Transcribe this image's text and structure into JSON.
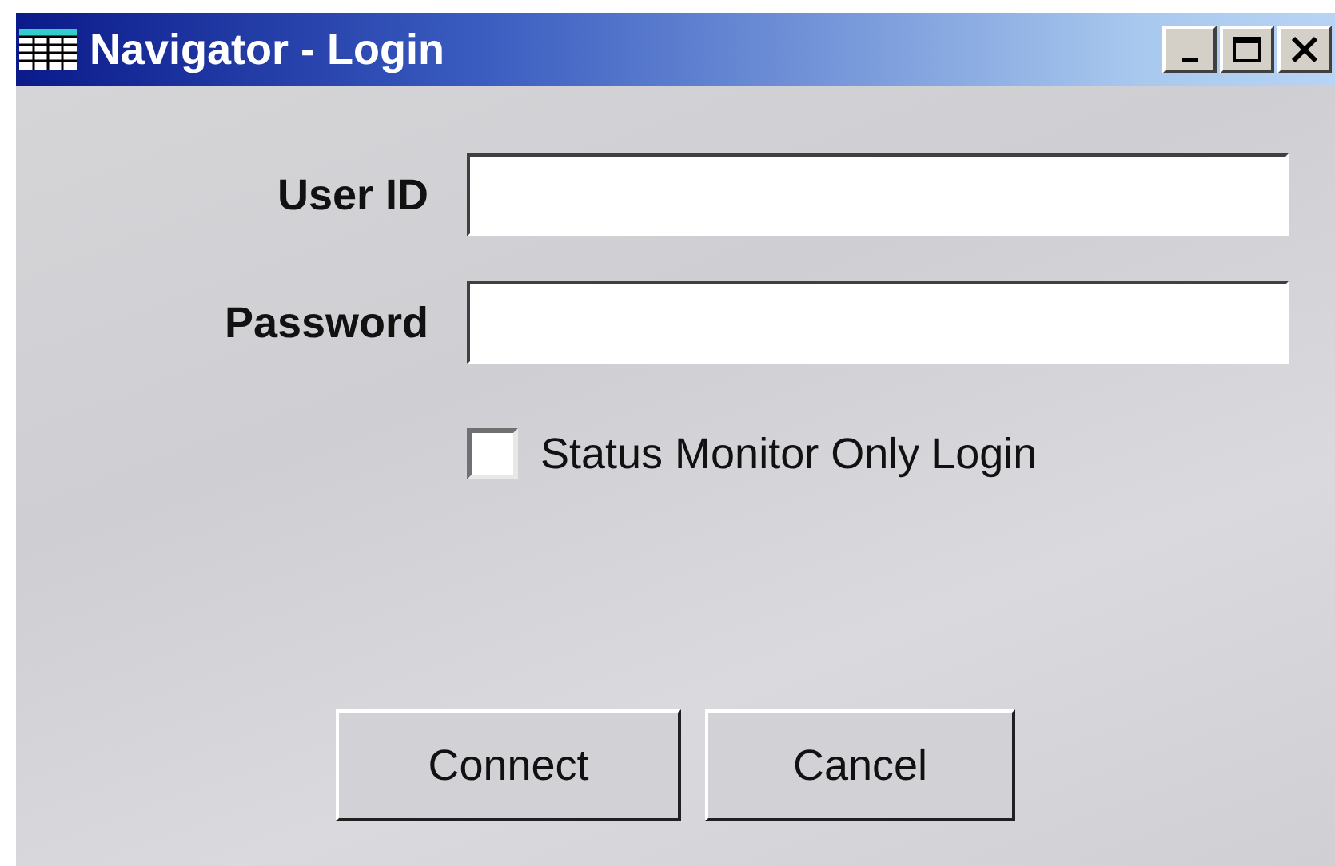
{
  "window": {
    "title": "Navigator - Login"
  },
  "fields": [
    {
      "label": "User ID"
    },
    {
      "label": "Password"
    }
  ],
  "checkbox": {
    "label": "Status Monitor Only Login",
    "checked": false
  },
  "buttons": [
    "Connect",
    "Cancel"
  ]
}
